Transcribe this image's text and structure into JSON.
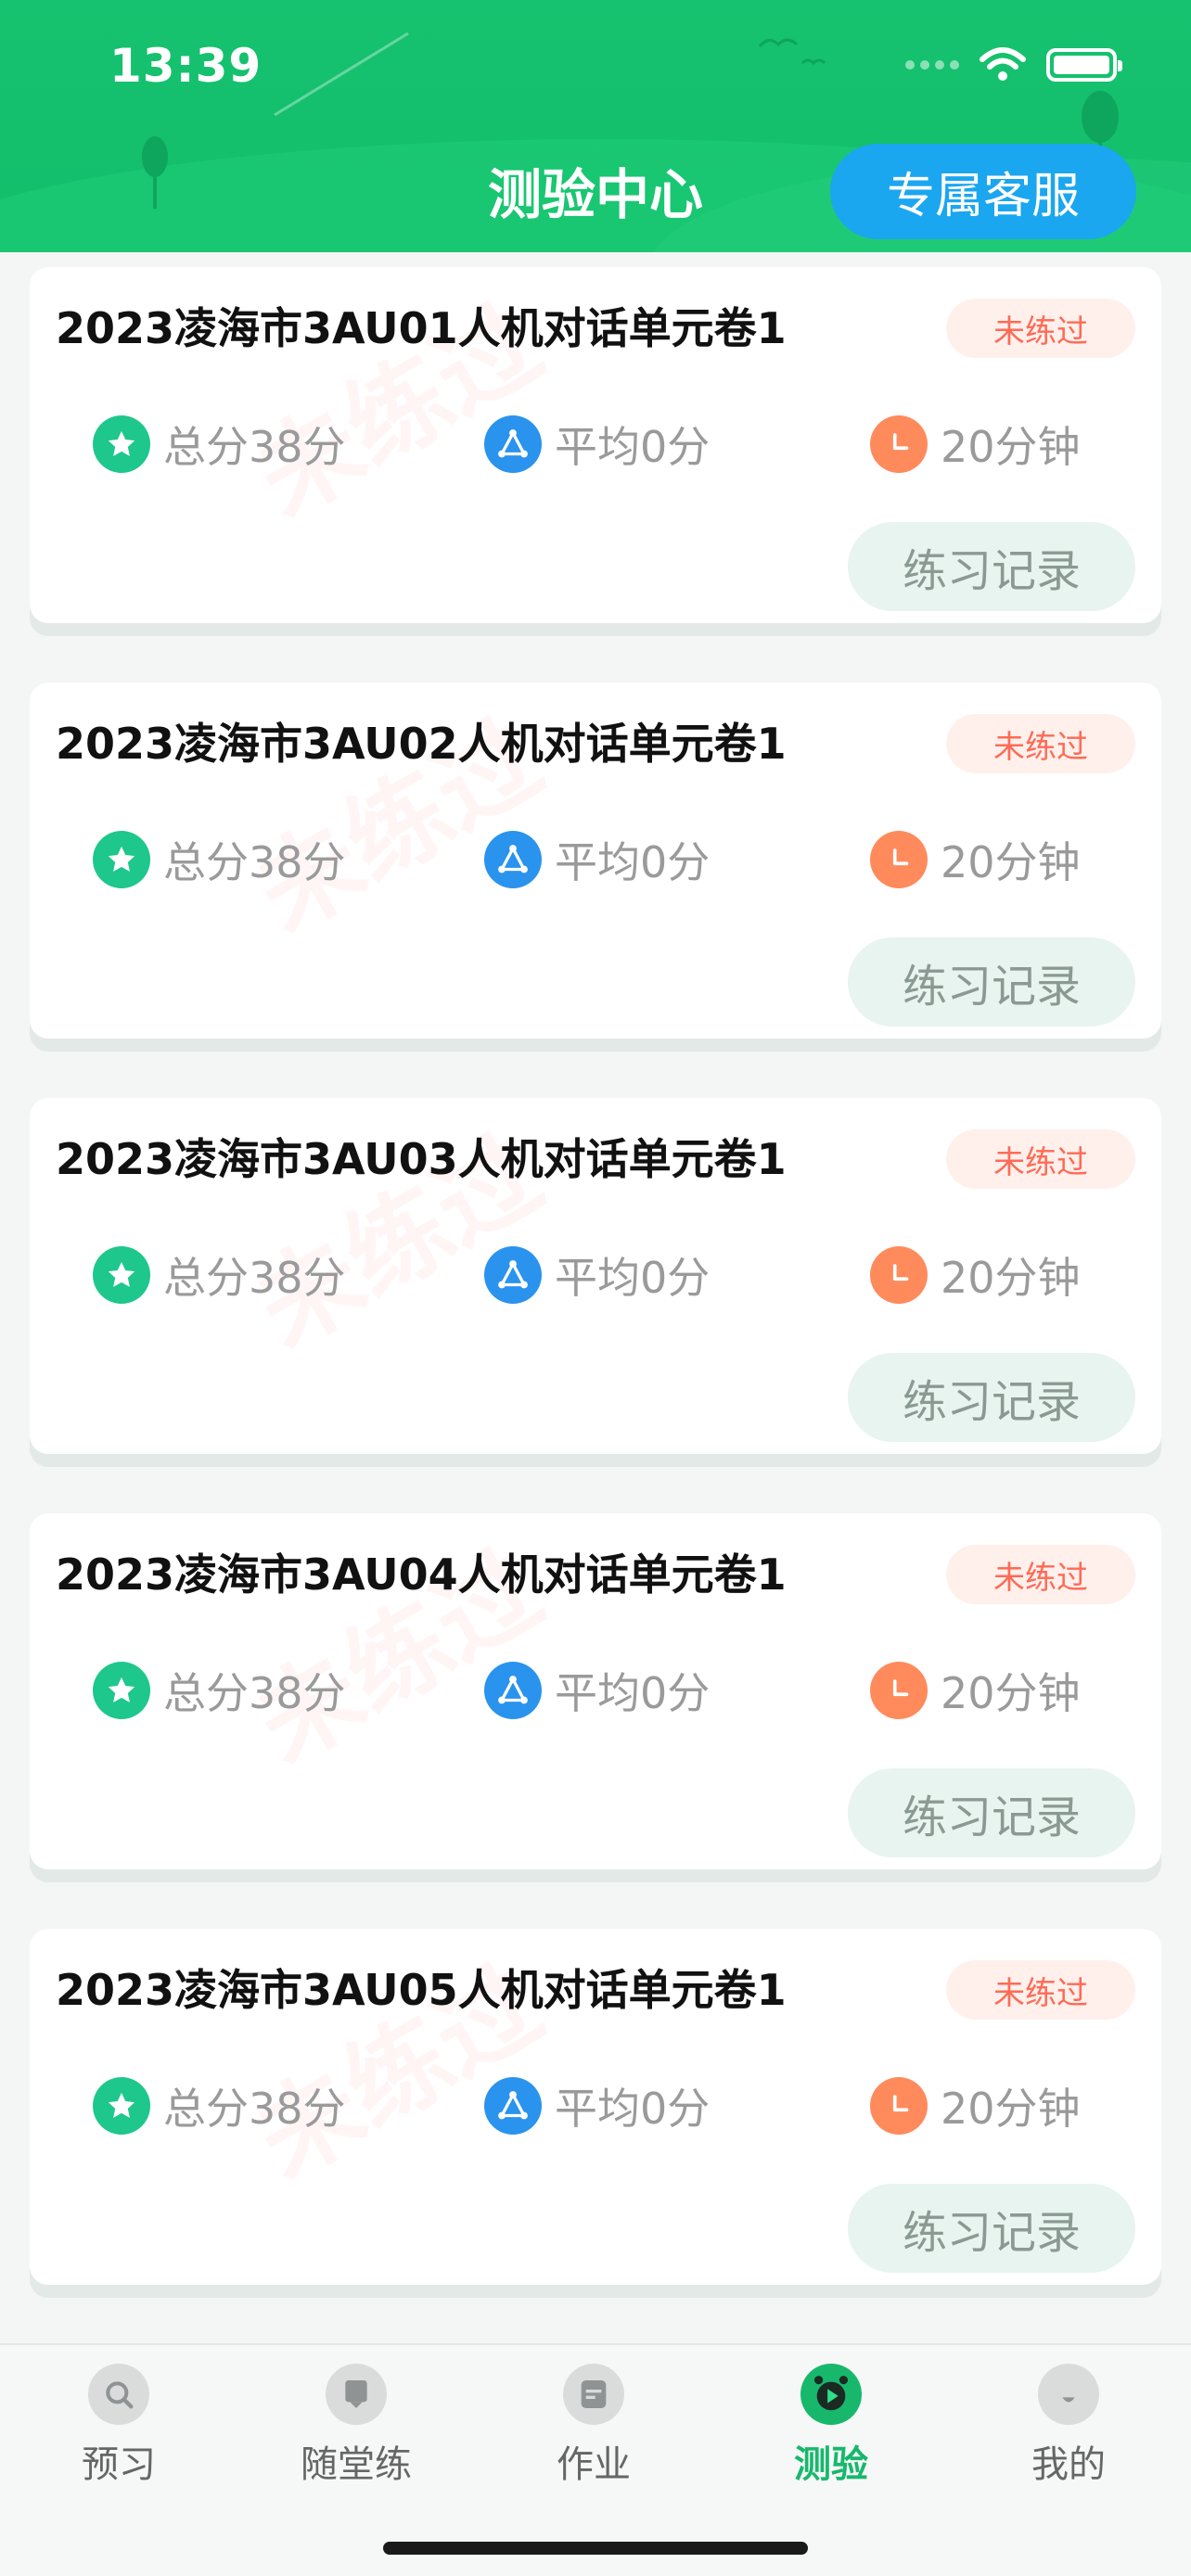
{
  "status_bar": {
    "time": "13:39"
  },
  "header": {
    "title": "测验中心",
    "service_button": "专属客服"
  },
  "cards": [
    {
      "title": "2023凌海市3AU01人机对话单元卷1",
      "status": "未练过",
      "total": "总分38分",
      "average": "平均0分",
      "duration": "20分钟",
      "action": "练习记录",
      "watermark": "未练过"
    },
    {
      "title": "2023凌海市3AU02人机对话单元卷1",
      "status": "未练过",
      "total": "总分38分",
      "average": "平均0分",
      "duration": "20分钟",
      "action": "练习记录",
      "watermark": "未练过"
    },
    {
      "title": "2023凌海市3AU03人机对话单元卷1",
      "status": "未练过",
      "total": "总分38分",
      "average": "平均0分",
      "duration": "20分钟",
      "action": "练习记录",
      "watermark": "未练过"
    },
    {
      "title": "2023凌海市3AU04人机对话单元卷1",
      "status": "未练过",
      "total": "总分38分",
      "average": "平均0分",
      "duration": "20分钟",
      "action": "练习记录",
      "watermark": "未练过"
    },
    {
      "title": "2023凌海市3AU05人机对话单元卷1",
      "status": "未练过",
      "total": "总分38分",
      "average": "平均0分",
      "duration": "20分钟",
      "action": "练习记录",
      "watermark": "未练过"
    }
  ],
  "tabbar": {
    "items": [
      {
        "label": "预习",
        "icon": "preview-icon"
      },
      {
        "label": "随堂练",
        "icon": "classroom-practice-icon"
      },
      {
        "label": "作业",
        "icon": "homework-icon"
      },
      {
        "label": "测验",
        "icon": "quiz-icon",
        "active": true
      },
      {
        "label": "我的",
        "icon": "profile-icon"
      }
    ]
  },
  "colors": {
    "brand_green": "#16c26f",
    "service_blue": "#1ba6f0",
    "badge_red": "#ff6a55"
  }
}
